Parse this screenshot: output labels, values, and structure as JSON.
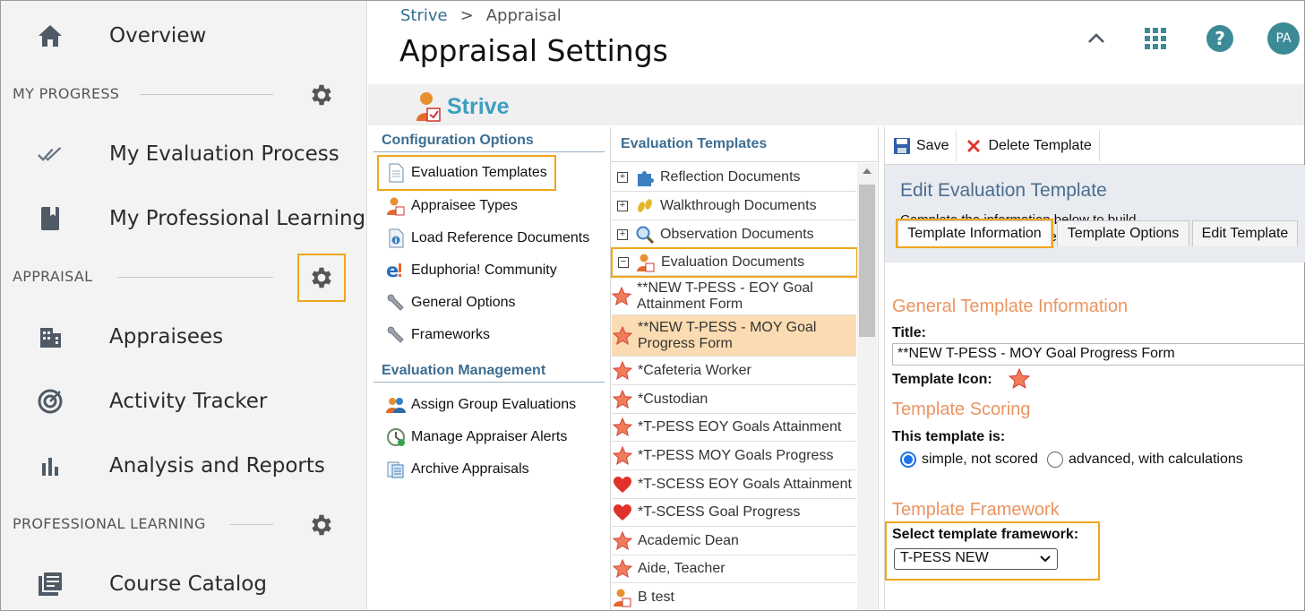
{
  "sidebar": {
    "items": [
      {
        "label": "Overview",
        "icon": "home-icon"
      },
      {
        "label": "My Evaluation Process",
        "icon": "double-check-icon"
      },
      {
        "label": "My Professional Learning",
        "icon": "book-icon"
      },
      {
        "label": "Appraisees",
        "icon": "building-icon"
      },
      {
        "label": "Activity Tracker",
        "icon": "target-icon"
      },
      {
        "label": "Analysis and Reports",
        "icon": "bar-chart-icon"
      },
      {
        "label": "Course Catalog",
        "icon": "catalog-icon"
      }
    ],
    "sections": [
      {
        "label": "MY PROGRESS"
      },
      {
        "label": "APPRAISAL"
      },
      {
        "label": "PROFESSIONAL LEARNING"
      }
    ]
  },
  "header": {
    "breadcrumb": [
      "Strive",
      "Appraisal"
    ],
    "title": "Appraisal Settings",
    "avatar_initials": "PA",
    "accent": "#3d8a97"
  },
  "logo": {
    "text": "Strive"
  },
  "config": {
    "heading": "Configuration Options",
    "items": [
      {
        "label": "Evaluation Templates"
      },
      {
        "label": "Appraisee Types"
      },
      {
        "label": "Load Reference Documents"
      },
      {
        "label": "Eduphoria! Community"
      },
      {
        "label": "General Options"
      },
      {
        "label": "Frameworks"
      }
    ],
    "mgmt_heading": "Evaluation Management",
    "mgmt_items": [
      {
        "label": "Assign Group Evaluations"
      },
      {
        "label": "Manage Appraiser Alerts"
      },
      {
        "label": "Archive Appraisals"
      }
    ]
  },
  "templates": {
    "heading": "Evaluation Templates",
    "rows": [
      {
        "label": "Reflection Documents",
        "expander": "+"
      },
      {
        "label": "Walkthrough Documents",
        "expander": "+"
      },
      {
        "label": "Observation Documents",
        "expander": "+"
      },
      {
        "label": "Evaluation Documents",
        "expander": "−"
      },
      {
        "label": "**NEW T-PESS - EOY Goal Attainment Form"
      },
      {
        "label": "**NEW T-PESS - MOY Goal Progress Form"
      },
      {
        "label": "*Cafeteria Worker"
      },
      {
        "label": "*Custodian"
      },
      {
        "label": "*T-PESS EOY Goals Attainment"
      },
      {
        "label": "*T-PESS MOY Goals Progress"
      },
      {
        "label": "*T-SCESS EOY Goals Attainment"
      },
      {
        "label": "*T-SCESS Goal Progress"
      },
      {
        "label": "Academic Dean"
      },
      {
        "label": "Aide, Teacher"
      },
      {
        "label": "B test"
      }
    ]
  },
  "editor": {
    "toolbar": {
      "save": "Save",
      "delete": "Delete Template"
    },
    "title": "Edit Evaluation Template",
    "description": "Complete the information below to build a staff evaluation template.",
    "tabs": [
      "Template Information",
      "Template Options",
      "Edit Template"
    ],
    "general_heading": "General Template Information",
    "title_label": "Title:",
    "title_value": "**NEW T-PESS - MOY Goal Progress Form",
    "icon_label": "Template Icon:",
    "scoring_heading": "Template Scoring",
    "scoring_label": "This template is:",
    "scoring_options": [
      "simple, not scored",
      "advanced, with calculations"
    ],
    "scoring_selected": "simple, not scored",
    "framework_heading": "Template Framework",
    "framework_label": "Select template framework:",
    "framework_value": "T-PESS NEW"
  },
  "colors": {
    "highlight": "#f0a61c",
    "section_heading": "#ec9460",
    "link_blue": "#3e6e92"
  }
}
